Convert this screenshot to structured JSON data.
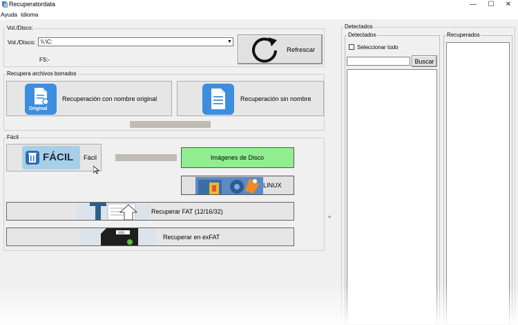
{
  "window": {
    "title": "Recuperatordata",
    "minimize": "—",
    "maximize": "☐",
    "close": "✕"
  },
  "menu": [
    "Ayuda",
    "Idioma"
  ],
  "volume": {
    "group_title": "Vol./Disco:",
    "label": "Vol./Disco:",
    "selected": "\\\\.\\C:",
    "fs_label": "FS:-",
    "refresh_label": "Refrescar"
  },
  "deleted": {
    "group_title": "Recupera archivos borrados",
    "original_name_button": "Recuperación con nombre original",
    "original_icon_caption": "Original",
    "no_name_button": "Recuperación sin nombre"
  },
  "easy": {
    "group_title": "Fácil",
    "easy_button": "Fácil",
    "easy_icon_caption": "FÁCIL",
    "disk_images_button": "Imágenes de Disco",
    "linux_button": "LINUX",
    "fat_button": "Recuperar FAT (12/16/32)",
    "exfat_button": "Recuperar en exFAT"
  },
  "right": {
    "group_title": "Detectados",
    "detected_title": "Detectados",
    "select_all": "Seleccionar todo",
    "search_placeholder": "",
    "search_button": "Buscar",
    "recovered_title": "Recuperados"
  },
  "colors": {
    "icon_blue": "#3d8ede",
    "disk_images_green": "#90ee90",
    "progress_gray": "#c0bcb4"
  }
}
